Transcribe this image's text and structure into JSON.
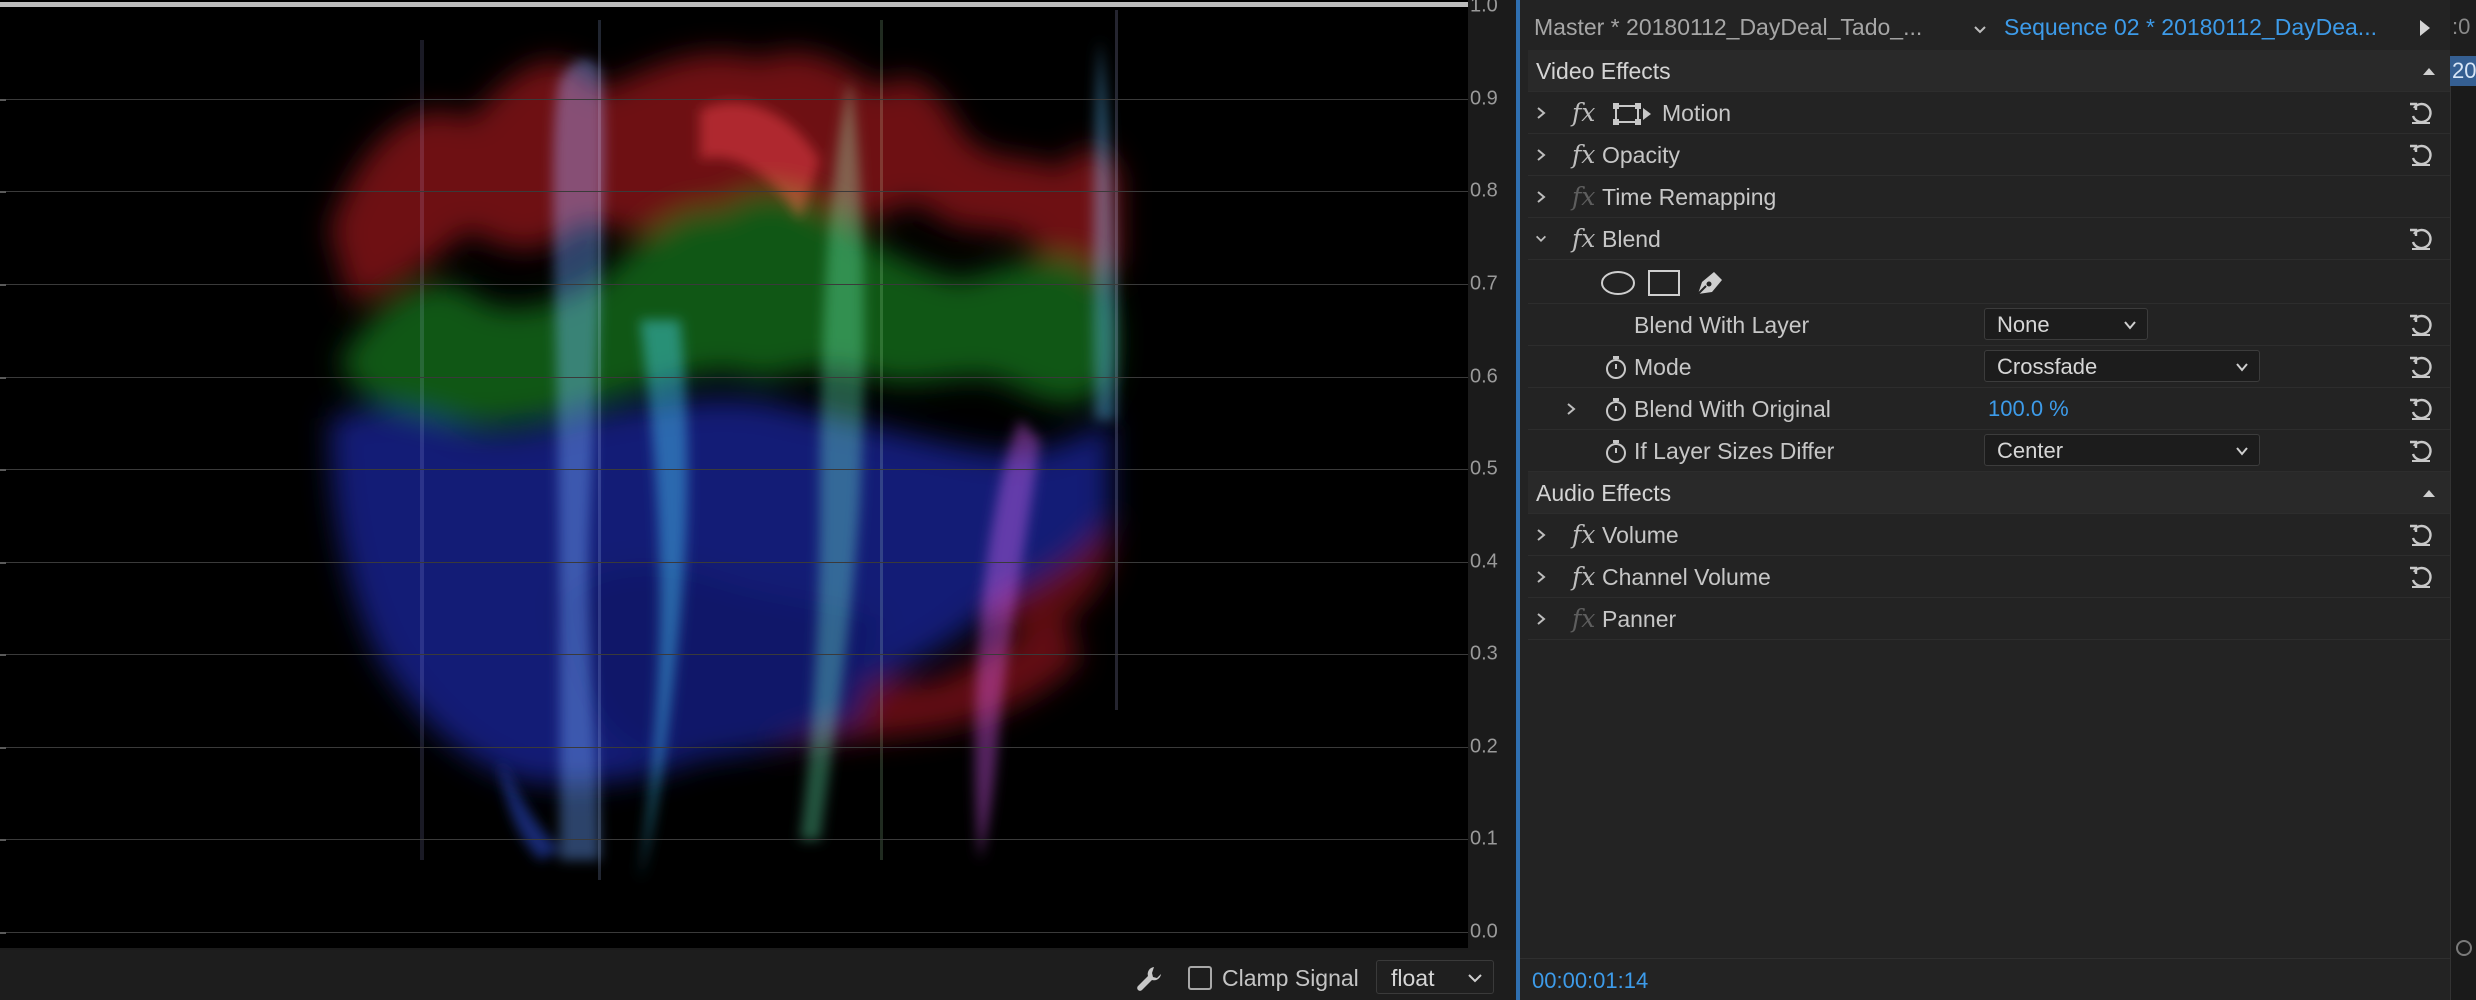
{
  "scope": {
    "y_axis_labels": [
      "1.0",
      "0.9",
      "0.8",
      "0.7",
      "0.6",
      "0.5",
      "0.4",
      "0.3",
      "0.2",
      "0.1",
      "0.0"
    ],
    "clamp_signal_label": "Clamp Signal",
    "clamp_signal_checked": false,
    "format_select_value": "float",
    "wrench_icon": "wrench-icon",
    "colors": {
      "red": "#e0262b",
      "green": "#21b52b",
      "blue": "#2f3ff0"
    }
  },
  "effect_controls": {
    "tab_master": "Master * 20180112_DayDeal_Tado_...",
    "tab_sequence": "Sequence 02 * 20180112_DayDea...",
    "timeline_timecode_fragment": ":0",
    "timeline_clip_fragment": "20",
    "video_effects_label": "Video Effects",
    "audio_effects_label": "Audio Effects",
    "effects": {
      "motion": "Motion",
      "opacity": "Opacity",
      "time_remapping": "Time Remapping",
      "blend": "Blend",
      "volume": "Volume",
      "channel_volume": "Channel Volume",
      "panner": "Panner"
    },
    "fx_symbol": "fx",
    "blend_params": {
      "blend_with_layer_label": "Blend With Layer",
      "blend_with_layer_value": "None",
      "mode_label": "Mode",
      "mode_value": "Crossfade",
      "blend_with_original_label": "Blend With Original",
      "blend_with_original_value": "100.0 %",
      "if_layer_sizes_differ_label": "If Layer Sizes Differ",
      "if_layer_sizes_differ_value": "Center"
    },
    "timecode": "00:00:01:14",
    "accent_color": "#3d9be9"
  }
}
